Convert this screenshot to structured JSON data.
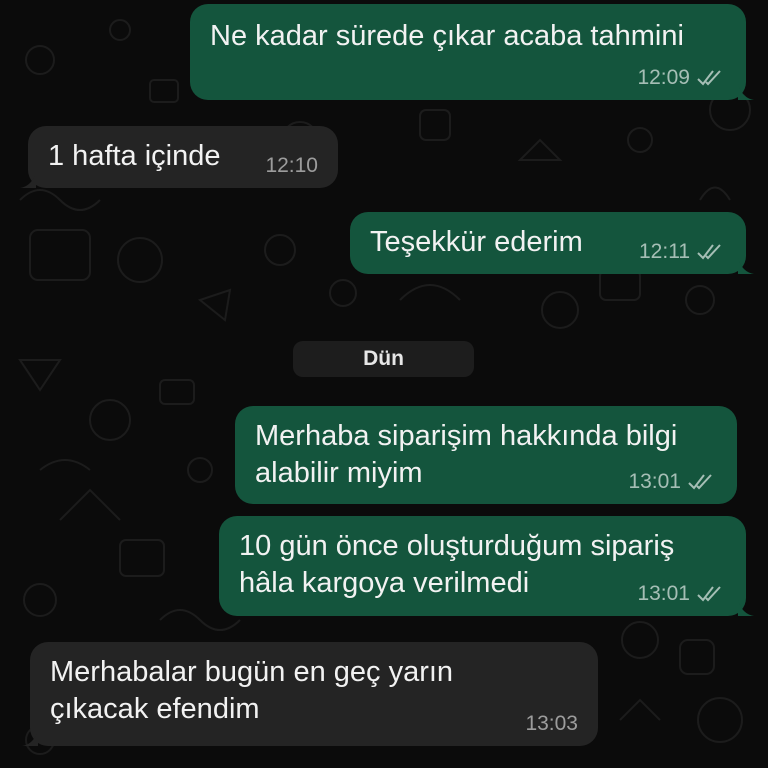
{
  "chat": {
    "messages": [
      {
        "direction": "out",
        "text": "Ne kadar sürede çıkar acaba tahmini",
        "time": "12:09",
        "status": "read-ticks-icon"
      },
      {
        "direction": "in",
        "text": "1 hafta içinde",
        "time": "12:10"
      },
      {
        "direction": "out",
        "text": "Teşekkür ederim",
        "time": "12:11",
        "status": "read-ticks-icon"
      },
      {
        "direction": "out",
        "lines": [
          "Merhaba siparişim hakkında bilgi",
          "alabilir miyim"
        ],
        "time": "13:01",
        "status": "read-ticks-icon"
      },
      {
        "direction": "out",
        "lines": [
          "10 gün önce oluşturduğum sipariş",
          "hâla kargoya verilmedi"
        ],
        "time": "13:01",
        "status": "read-ticks-icon"
      },
      {
        "direction": "in",
        "lines": [
          "Merhabalar bugün en geç yarın",
          "çıkacak efendim"
        ],
        "time": "13:03"
      }
    ],
    "date_separator": "Dün"
  },
  "colors": {
    "background": "#0b0b0b",
    "outgoing_bubble": "#14553d",
    "incoming_bubble": "#242424",
    "text": "#f2f2f2",
    "meta": "#a3a3a3"
  }
}
